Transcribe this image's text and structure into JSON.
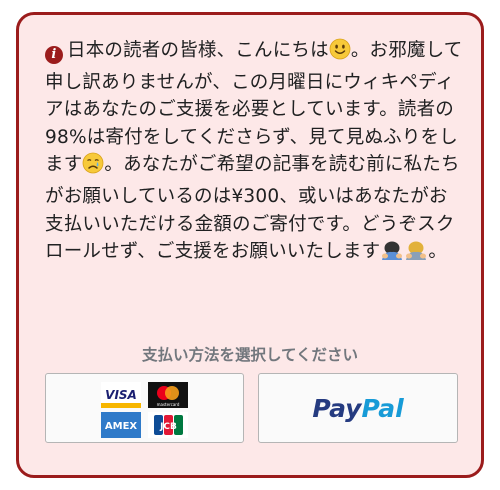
{
  "banner": {
    "message": {
      "part1": "日本の読者の皆様、こんにちは",
      "part2": "。お邪魔して申し訳ありませんが、この月曜日にウィキペディアはあなたのご支援を必要としています。読者の98%は寄付をしてくださらず、見て見ぬふりをします",
      "part3": "。あなたがご希望の記事を読む前に私たちがお願いしているのは¥300、或いはあなたがお支払いいただける金額のご寄付です。どうぞスクロールせず、ご支援をお願いいたします",
      "part4": "。"
    },
    "icons": {
      "info": "i",
      "info_name": "info-icon",
      "smile": "smiling-face-emoji",
      "sad": "sad-crying-face-emoji",
      "bow": "bowing-person-emoji"
    },
    "payment_label": "支払い方法を選択してください",
    "card_button": {
      "visa": "VISA",
      "mastercard": "mastercard",
      "amex": "AMEX",
      "jcb": "JCB"
    },
    "paypal_button": {
      "pay": "Pay",
      "pal": "Pal"
    },
    "colors": {
      "background": "#fde8e8",
      "border": "#9b1c1c",
      "paypal_dark": "#253b80",
      "paypal_light": "#179bd7"
    }
  }
}
